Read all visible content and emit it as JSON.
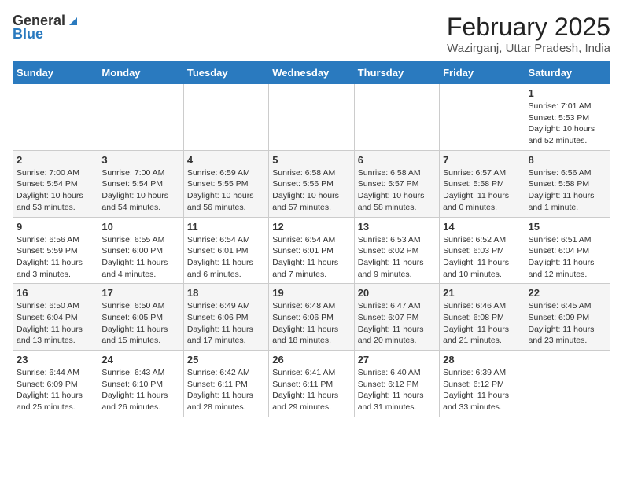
{
  "header": {
    "logo_general": "General",
    "logo_blue": "Blue",
    "month_title": "February 2025",
    "location": "Wazirganj, Uttar Pradesh, India"
  },
  "weekdays": [
    "Sunday",
    "Monday",
    "Tuesday",
    "Wednesday",
    "Thursday",
    "Friday",
    "Saturday"
  ],
  "weeks": [
    [
      {
        "day": "",
        "info": ""
      },
      {
        "day": "",
        "info": ""
      },
      {
        "day": "",
        "info": ""
      },
      {
        "day": "",
        "info": ""
      },
      {
        "day": "",
        "info": ""
      },
      {
        "day": "",
        "info": ""
      },
      {
        "day": "1",
        "info": "Sunrise: 7:01 AM\nSunset: 5:53 PM\nDaylight: 10 hours\nand 52 minutes."
      }
    ],
    [
      {
        "day": "2",
        "info": "Sunrise: 7:00 AM\nSunset: 5:54 PM\nDaylight: 10 hours\nand 53 minutes."
      },
      {
        "day": "3",
        "info": "Sunrise: 7:00 AM\nSunset: 5:54 PM\nDaylight: 10 hours\nand 54 minutes."
      },
      {
        "day": "4",
        "info": "Sunrise: 6:59 AM\nSunset: 5:55 PM\nDaylight: 10 hours\nand 56 minutes."
      },
      {
        "day": "5",
        "info": "Sunrise: 6:58 AM\nSunset: 5:56 PM\nDaylight: 10 hours\nand 57 minutes."
      },
      {
        "day": "6",
        "info": "Sunrise: 6:58 AM\nSunset: 5:57 PM\nDaylight: 10 hours\nand 58 minutes."
      },
      {
        "day": "7",
        "info": "Sunrise: 6:57 AM\nSunset: 5:58 PM\nDaylight: 11 hours\nand 0 minutes."
      },
      {
        "day": "8",
        "info": "Sunrise: 6:56 AM\nSunset: 5:58 PM\nDaylight: 11 hours\nand 1 minute."
      }
    ],
    [
      {
        "day": "9",
        "info": "Sunrise: 6:56 AM\nSunset: 5:59 PM\nDaylight: 11 hours\nand 3 minutes."
      },
      {
        "day": "10",
        "info": "Sunrise: 6:55 AM\nSunset: 6:00 PM\nDaylight: 11 hours\nand 4 minutes."
      },
      {
        "day": "11",
        "info": "Sunrise: 6:54 AM\nSunset: 6:01 PM\nDaylight: 11 hours\nand 6 minutes."
      },
      {
        "day": "12",
        "info": "Sunrise: 6:54 AM\nSunset: 6:01 PM\nDaylight: 11 hours\nand 7 minutes."
      },
      {
        "day": "13",
        "info": "Sunrise: 6:53 AM\nSunset: 6:02 PM\nDaylight: 11 hours\nand 9 minutes."
      },
      {
        "day": "14",
        "info": "Sunrise: 6:52 AM\nSunset: 6:03 PM\nDaylight: 11 hours\nand 10 minutes."
      },
      {
        "day": "15",
        "info": "Sunrise: 6:51 AM\nSunset: 6:04 PM\nDaylight: 11 hours\nand 12 minutes."
      }
    ],
    [
      {
        "day": "16",
        "info": "Sunrise: 6:50 AM\nSunset: 6:04 PM\nDaylight: 11 hours\nand 13 minutes."
      },
      {
        "day": "17",
        "info": "Sunrise: 6:50 AM\nSunset: 6:05 PM\nDaylight: 11 hours\nand 15 minutes."
      },
      {
        "day": "18",
        "info": "Sunrise: 6:49 AM\nSunset: 6:06 PM\nDaylight: 11 hours\nand 17 minutes."
      },
      {
        "day": "19",
        "info": "Sunrise: 6:48 AM\nSunset: 6:06 PM\nDaylight: 11 hours\nand 18 minutes."
      },
      {
        "day": "20",
        "info": "Sunrise: 6:47 AM\nSunset: 6:07 PM\nDaylight: 11 hours\nand 20 minutes."
      },
      {
        "day": "21",
        "info": "Sunrise: 6:46 AM\nSunset: 6:08 PM\nDaylight: 11 hours\nand 21 minutes."
      },
      {
        "day": "22",
        "info": "Sunrise: 6:45 AM\nSunset: 6:09 PM\nDaylight: 11 hours\nand 23 minutes."
      }
    ],
    [
      {
        "day": "23",
        "info": "Sunrise: 6:44 AM\nSunset: 6:09 PM\nDaylight: 11 hours\nand 25 minutes."
      },
      {
        "day": "24",
        "info": "Sunrise: 6:43 AM\nSunset: 6:10 PM\nDaylight: 11 hours\nand 26 minutes."
      },
      {
        "day": "25",
        "info": "Sunrise: 6:42 AM\nSunset: 6:11 PM\nDaylight: 11 hours\nand 28 minutes."
      },
      {
        "day": "26",
        "info": "Sunrise: 6:41 AM\nSunset: 6:11 PM\nDaylight: 11 hours\nand 29 minutes."
      },
      {
        "day": "27",
        "info": "Sunrise: 6:40 AM\nSunset: 6:12 PM\nDaylight: 11 hours\nand 31 minutes."
      },
      {
        "day": "28",
        "info": "Sunrise: 6:39 AM\nSunset: 6:12 PM\nDaylight: 11 hours\nand 33 minutes."
      },
      {
        "day": "",
        "info": ""
      }
    ]
  ]
}
